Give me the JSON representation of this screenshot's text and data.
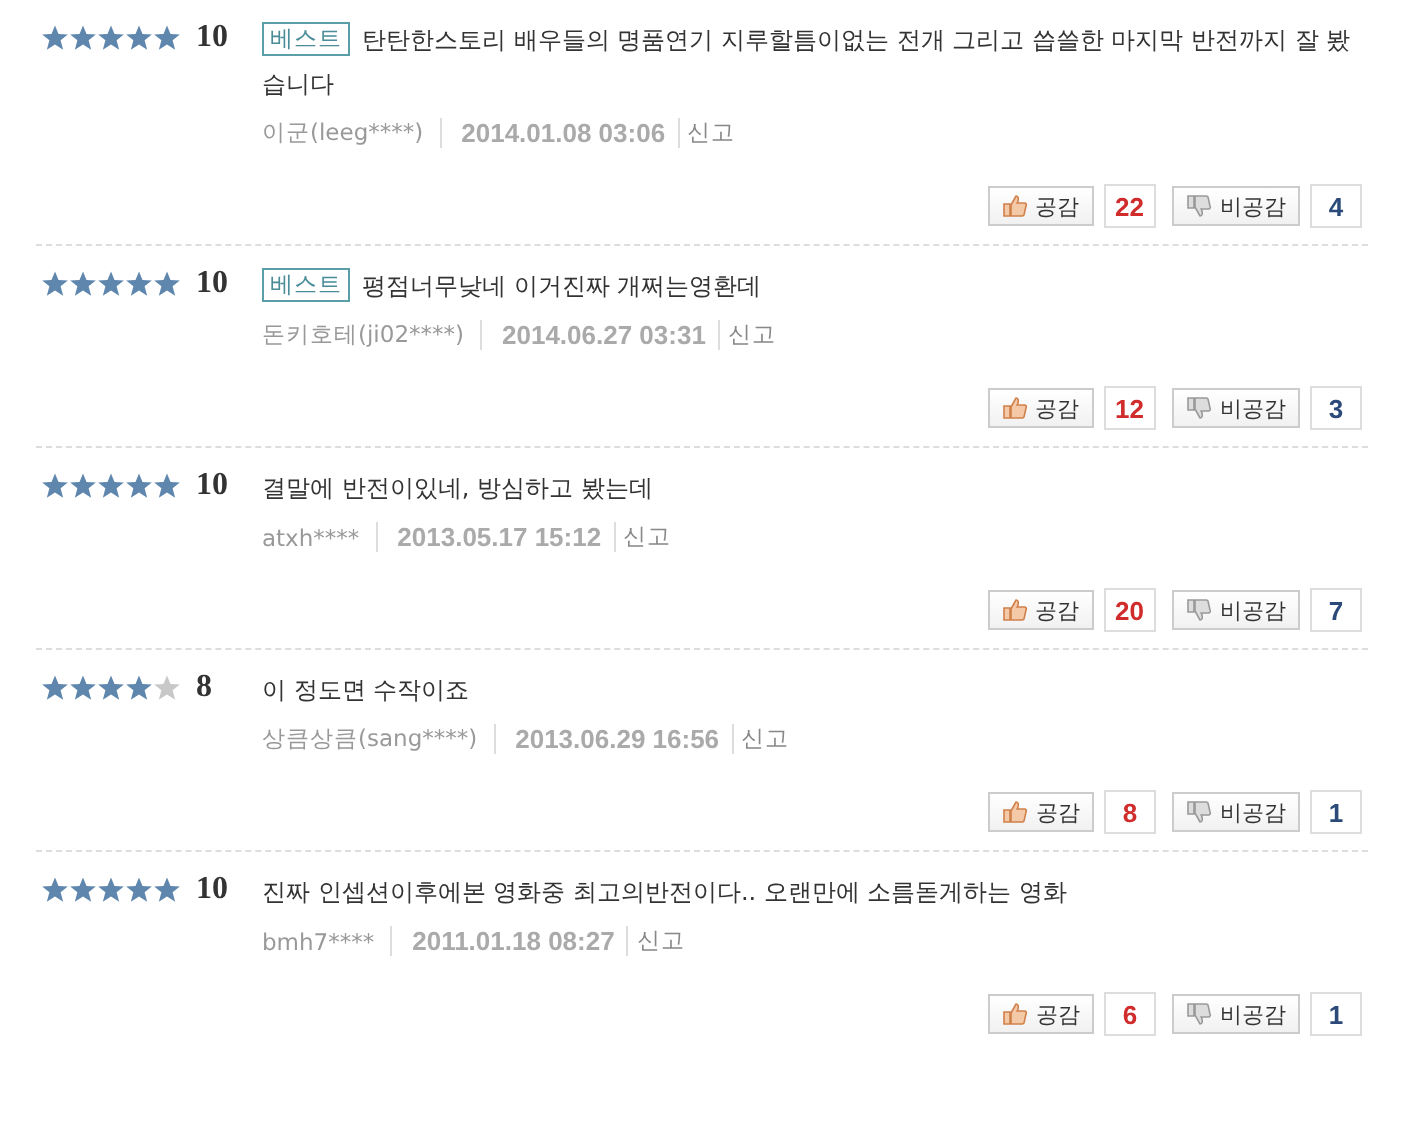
{
  "reviews": [
    {
      "stars": 5,
      "score": "10",
      "badge": "베스트",
      "text": "탄탄한스토리 배우들의 명품연기 지루할틈이없는 전개 그리고 씁쓸한 마지막 반전까지 잘 봤습니다",
      "author": "이군(leeg****)",
      "date": "2014.01.08 03:06",
      "report": "신고",
      "like_label": "공감",
      "likes": "22",
      "dislike_label": "비공감",
      "dislikes": "4"
    },
    {
      "stars": 5,
      "score": "10",
      "badge": "베스트",
      "text": "평점너무낮네 이거진짜 개쩌는영환데",
      "author": "돈키호테(ji02****)",
      "date": "2014.06.27 03:31",
      "report": "신고",
      "like_label": "공감",
      "likes": "12",
      "dislike_label": "비공감",
      "dislikes": "3"
    },
    {
      "stars": 5,
      "score": "10",
      "text": "결말에 반전이있네, 방심하고 봤는데",
      "author": "atxh****",
      "date": "2013.05.17 15:12",
      "report": "신고",
      "like_label": "공감",
      "likes": "20",
      "dislike_label": "비공감",
      "dislikes": "7"
    },
    {
      "stars": 4,
      "score": "8",
      "text": "이 정도면 수작이죠",
      "author": "상큼상큼(sang****)",
      "date": "2013.06.29 16:56",
      "report": "신고",
      "like_label": "공감",
      "likes": "8",
      "dislike_label": "비공감",
      "dislikes": "1"
    },
    {
      "stars": 5,
      "score": "10",
      "text": "진짜 인셉션이후에본 영화중 최고의반전이다.. 오랜만에 소름돋게하는 영화",
      "author": "bmh7****",
      "date": "2011.01.18 08:27",
      "report": "신고",
      "like_label": "공감",
      "likes": "6",
      "dislike_label": "비공감",
      "dislikes": "1"
    }
  ]
}
